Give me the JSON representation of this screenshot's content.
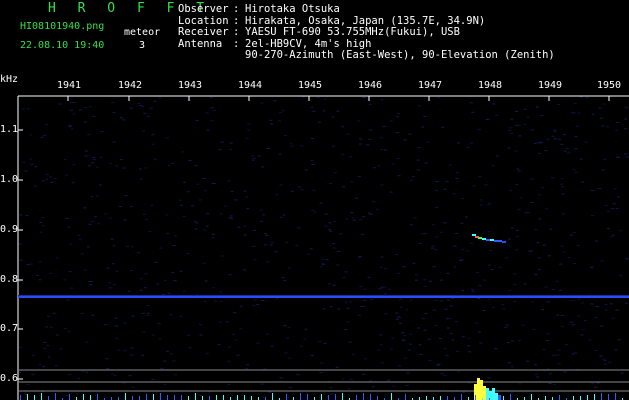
{
  "app": {
    "title": "H R O F F T",
    "filename": "HI08101940.png",
    "datetime": "22.08.10 19:40",
    "meteor_label": "meteor",
    "meteor_count": "3"
  },
  "station": [
    {
      "key": "Observer",
      "value": "Hirotaka Otsuka"
    },
    {
      "key": "Location",
      "value": "Hirakata, Osaka, Japan (135.7E, 34.9N)"
    },
    {
      "key": "Receiver",
      "value": "YAESU FT-690 53.755MHz(Fukui), USB"
    },
    {
      "key": "Antenna",
      "value": "2el-HB9CV, 4m's high"
    },
    {
      "key": "",
      "value": "90-270-Azimuth (East-West), 90-Elevation (Zenith)"
    }
  ],
  "axes": {
    "y_unit": "kHz",
    "x_ticks": [
      "1941",
      "1942",
      "1943",
      "1944",
      "1945",
      "1946",
      "1947",
      "1948",
      "1949",
      "1950"
    ],
    "y_ticks": [
      "1.1",
      "1.0",
      "0.9",
      "0.8",
      "0.7",
      "0.6"
    ]
  },
  "colors": {
    "title_green": "#33e04a",
    "axis": "#ffffff",
    "carrier": "#2a4cff",
    "echo_yellow": "#ffff40",
    "echo_cyan": "#40ffff"
  }
}
